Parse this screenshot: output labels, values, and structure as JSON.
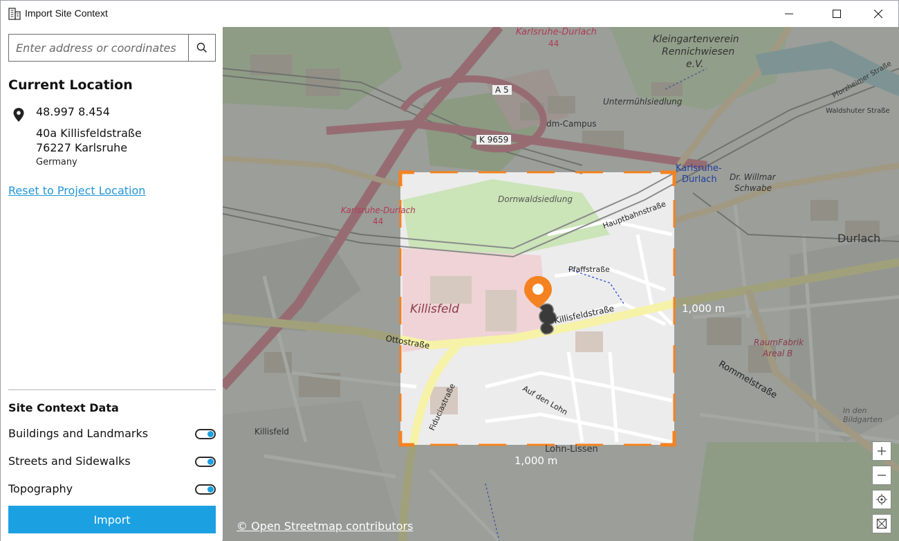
{
  "window": {
    "title": "Import Site Context",
    "app_icon": "building-icon"
  },
  "search": {
    "placeholder": "Enter address or coordinates",
    "value": "",
    "icon": "search-icon"
  },
  "current_location": {
    "title": "Current Location",
    "coordinates": "48.997 8.454",
    "address_line1": "40a Killisfeldstraße",
    "address_line2": "76227 Karlsruhe",
    "country": "Germany",
    "reset_link": "Reset to Project Location"
  },
  "site_context": {
    "title": "Site Context Data",
    "toggles": [
      {
        "label": "Buildings and Landmarks",
        "on": true
      },
      {
        "label": "Streets and Sidewalks",
        "on": true
      },
      {
        "label": "Topography",
        "on": true
      }
    ],
    "import_label": "Import"
  },
  "map": {
    "width_label": "1,000 m",
    "height_label": "1,000 m",
    "credit": "© Open Streetmap contributors",
    "accent_color": "#f58220",
    "labels": {
      "durlach_top": "Karlsruhe-Durlach",
      "durlach_top_num": "44",
      "kleingarten": "Kleingartenverein",
      "rennichwiesen": "Rennichwiesen",
      "ev": "e.V.",
      "a5": "A 5",
      "untermuhl": "Untermühlsiedlung",
      "dm_campus": "dm-Campus",
      "k9659": "K 9659",
      "dornwald": "Dornwaldsiedlung",
      "karlsruhe_durlach_r": "Karlsruhe-",
      "durlach_r": "Durlach",
      "willmar": "Dr. Willmar",
      "schwabe": "Schwabe",
      "durlach_big": "Durlach",
      "karlsruhe_durlach_mid": "Karlsruhe-Durlach",
      "mid_num": "44",
      "killisfeld_big": "Killisfeld",
      "killisfeldstrasse": "Killisfeldstraße",
      "ottostrasse": "Ottostraße",
      "pfaffstrasse": "Pfaffstraße",
      "hauptbahnstrasse": "Hauptbahnstraße",
      "raumfabrik": "RaumFabrik",
      "areal_b": "Areal B",
      "rommelstrasse": "Rommelstraße",
      "killisfeld_small": "Killisfeld",
      "lohn_lissen": "Lohn-Lissen",
      "auf_den_lohn": "Auf den Lohn",
      "fiduciastrasse": "Fiduciastraße",
      "in_den_bildgarten": "In den\nBildgarten",
      "waldshuter": "Waldshuter Straße",
      "pforzheimer": "Pforzheimer Straße"
    }
  },
  "map_controls": [
    {
      "name": "zoom-in",
      "glyph": "+"
    },
    {
      "name": "zoom-out",
      "glyph": "−"
    },
    {
      "name": "locate",
      "glyph": "◎"
    },
    {
      "name": "fit",
      "glyph": "⊠"
    }
  ]
}
